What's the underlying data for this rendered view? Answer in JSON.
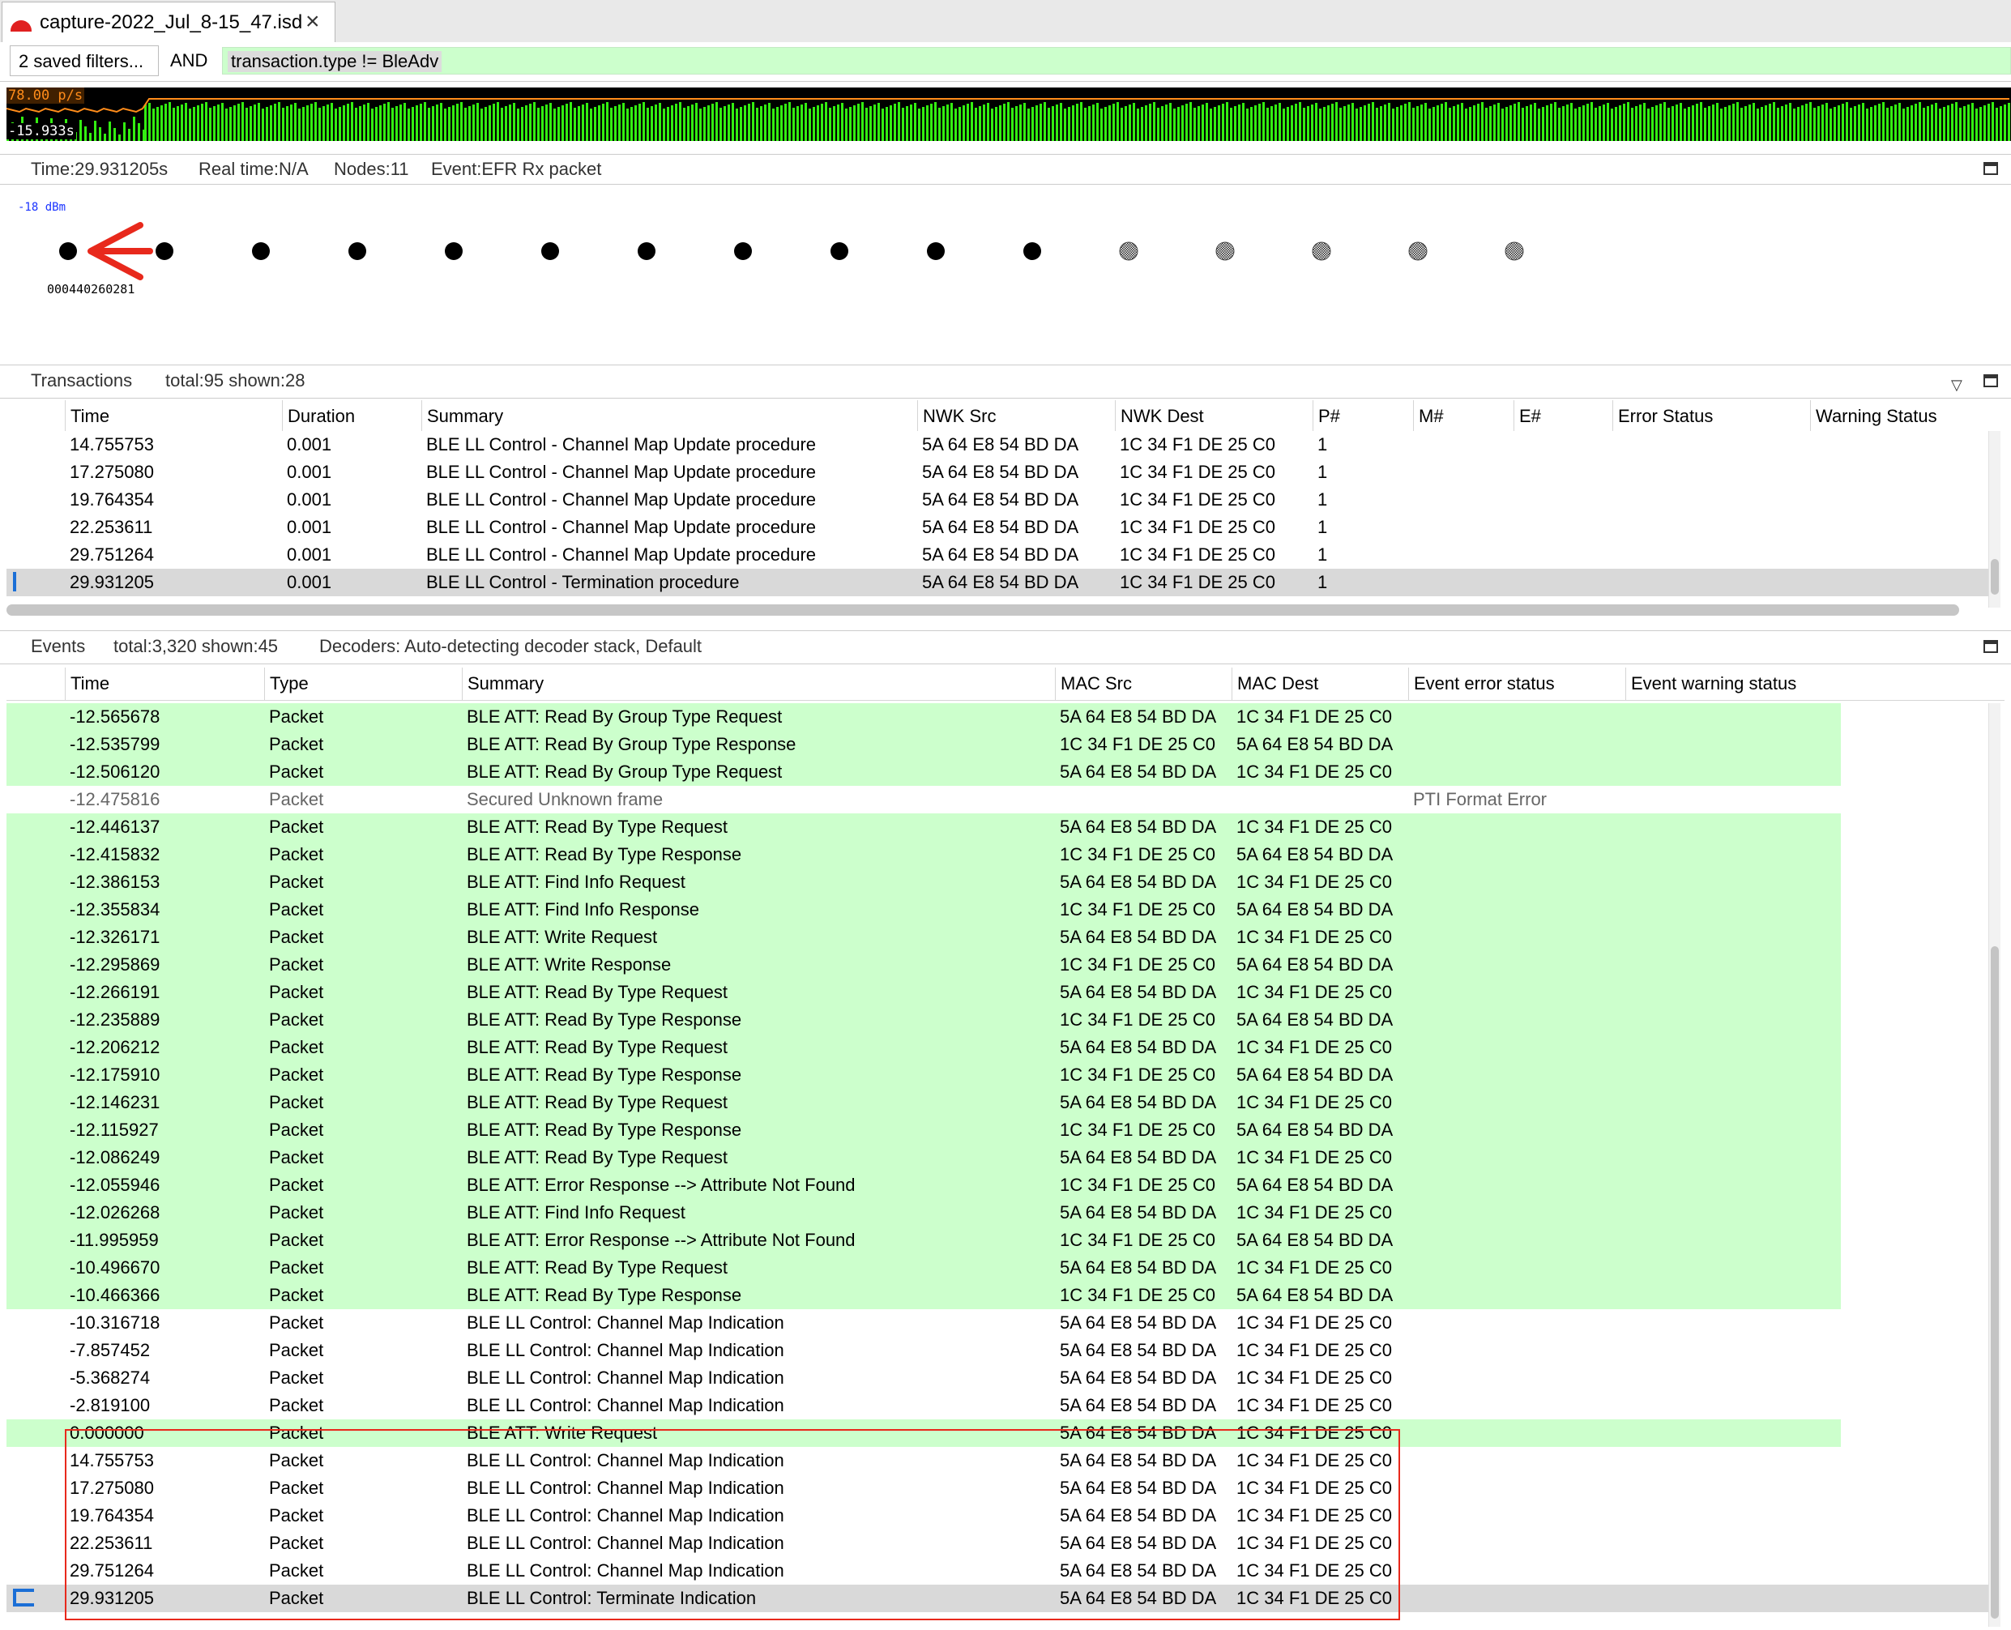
{
  "tab": {
    "title": "capture-2022_Jul_8-15_47.isd"
  },
  "filter": {
    "saved_filters": "2 saved filters...",
    "operator": "AND",
    "expression": "transaction.type != BleAdv"
  },
  "activity": {
    "top_label": "78.00 p/s",
    "bottom_label": "-15.933s"
  },
  "node_info": {
    "time": "Time:29.931205s",
    "real_time": "Real time:N/A",
    "nodes": "Nodes:11",
    "event": "Event:EFR Rx packet",
    "dbm_label": "-18 dBm",
    "node_id": "000440260281"
  },
  "nodes": {
    "active_count": 11,
    "inactive_count": 5
  },
  "transactions": {
    "title": "Transactions",
    "stats": "total:95 shown:28",
    "columns": [
      "Time",
      "Duration",
      "Summary",
      "NWK Src",
      "NWK Dest",
      "P#",
      "M#",
      "E#",
      "Error Status",
      "Warning Status"
    ],
    "rows": [
      {
        "time": "14.755753",
        "duration": "0.001",
        "summary": "BLE LL Control - Channel Map Update procedure",
        "src": "5A 64 E8 54 BD DA",
        "dest": "1C 34 F1 DE 25 C0",
        "p": "1"
      },
      {
        "time": "17.275080",
        "duration": "0.001",
        "summary": "BLE LL Control - Channel Map Update procedure",
        "src": "5A 64 E8 54 BD DA",
        "dest": "1C 34 F1 DE 25 C0",
        "p": "1"
      },
      {
        "time": "19.764354",
        "duration": "0.001",
        "summary": "BLE LL Control - Channel Map Update procedure",
        "src": "5A 64 E8 54 BD DA",
        "dest": "1C 34 F1 DE 25 C0",
        "p": "1"
      },
      {
        "time": "22.253611",
        "duration": "0.001",
        "summary": "BLE LL Control - Channel Map Update procedure",
        "src": "5A 64 E8 54 BD DA",
        "dest": "1C 34 F1 DE 25 C0",
        "p": "1"
      },
      {
        "time": "29.751264",
        "duration": "0.001",
        "summary": "BLE LL Control - Channel Map Update procedure",
        "src": "5A 64 E8 54 BD DA",
        "dest": "1C 34 F1 DE 25 C0",
        "p": "1"
      },
      {
        "time": "29.931205",
        "duration": "0.001",
        "summary": "BLE LL Control - Termination procedure",
        "src": "5A 64 E8 54 BD DA",
        "dest": "1C 34 F1 DE 25 C0",
        "p": "1",
        "selected": true
      }
    ]
  },
  "events": {
    "title": "Events",
    "stats": "total:3,320 shown:45",
    "decoders": "Decoders: Auto-detecting decoder stack, Default",
    "columns": [
      "Time",
      "Type",
      "Summary",
      "MAC Src",
      "MAC Dest",
      "Event error status",
      "Event warning status"
    ],
    "rows": [
      {
        "time": "-12.565678",
        "type": "Packet",
        "summary": "BLE ATT: Read By Group Type Request",
        "src": "5A 64 E8 54 BD DA",
        "dest": "1C 34 F1 DE 25 C0",
        "bg": "green"
      },
      {
        "time": "-12.535799",
        "type": "Packet",
        "summary": "BLE ATT: Read By Group Type Response",
        "src": "1C 34 F1 DE 25 C0",
        "dest": "5A 64 E8 54 BD DA",
        "bg": "green"
      },
      {
        "time": "-12.506120",
        "type": "Packet",
        "summary": "BLE ATT: Read By Group Type Request",
        "src": "5A 64 E8 54 BD DA",
        "dest": "1C 34 F1 DE 25 C0",
        "bg": "green"
      },
      {
        "time": "-12.475816",
        "type": "Packet",
        "summary": "Secured Unknown frame",
        "src": "",
        "dest": "",
        "error": "PTI Format Error",
        "bg": "white",
        "gray": true
      },
      {
        "time": "-12.446137",
        "type": "Packet",
        "summary": "BLE ATT: Read By Type Request",
        "src": "5A 64 E8 54 BD DA",
        "dest": "1C 34 F1 DE 25 C0",
        "bg": "green"
      },
      {
        "time": "-12.415832",
        "type": "Packet",
        "summary": "BLE ATT: Read By Type Response",
        "src": "1C 34 F1 DE 25 C0",
        "dest": "5A 64 E8 54 BD DA",
        "bg": "green"
      },
      {
        "time": "-12.386153",
        "type": "Packet",
        "summary": "BLE ATT: Find Info Request",
        "src": "5A 64 E8 54 BD DA",
        "dest": "1C 34 F1 DE 25 C0",
        "bg": "green"
      },
      {
        "time": "-12.355834",
        "type": "Packet",
        "summary": "BLE ATT: Find Info Response",
        "src": "1C 34 F1 DE 25 C0",
        "dest": "5A 64 E8 54 BD DA",
        "bg": "green"
      },
      {
        "time": "-12.326171",
        "type": "Packet",
        "summary": "BLE ATT: Write Request",
        "src": "5A 64 E8 54 BD DA",
        "dest": "1C 34 F1 DE 25 C0",
        "bg": "green"
      },
      {
        "time": "-12.295869",
        "type": "Packet",
        "summary": "BLE ATT: Write Response",
        "src": "1C 34 F1 DE 25 C0",
        "dest": "5A 64 E8 54 BD DA",
        "bg": "green"
      },
      {
        "time": "-12.266191",
        "type": "Packet",
        "summary": "BLE ATT: Read By Type Request",
        "src": "5A 64 E8 54 BD DA",
        "dest": "1C 34 F1 DE 25 C0",
        "bg": "green"
      },
      {
        "time": "-12.235889",
        "type": "Packet",
        "summary": "BLE ATT: Read By Type Response",
        "src": "1C 34 F1 DE 25 C0",
        "dest": "5A 64 E8 54 BD DA",
        "bg": "green"
      },
      {
        "time": "-12.206212",
        "type": "Packet",
        "summary": "BLE ATT: Read By Type Request",
        "src": "5A 64 E8 54 BD DA",
        "dest": "1C 34 F1 DE 25 C0",
        "bg": "green"
      },
      {
        "time": "-12.175910",
        "type": "Packet",
        "summary": "BLE ATT: Read By Type Response",
        "src": "1C 34 F1 DE 25 C0",
        "dest": "5A 64 E8 54 BD DA",
        "bg": "green"
      },
      {
        "time": "-12.146231",
        "type": "Packet",
        "summary": "BLE ATT: Read By Type Request",
        "src": "5A 64 E8 54 BD DA",
        "dest": "1C 34 F1 DE 25 C0",
        "bg": "green"
      },
      {
        "time": "-12.115927",
        "type": "Packet",
        "summary": "BLE ATT: Read By Type Response",
        "src": "1C 34 F1 DE 25 C0",
        "dest": "5A 64 E8 54 BD DA",
        "bg": "green"
      },
      {
        "time": "-12.086249",
        "type": "Packet",
        "summary": "BLE ATT: Read By Type Request",
        "src": "5A 64 E8 54 BD DA",
        "dest": "1C 34 F1 DE 25 C0",
        "bg": "green"
      },
      {
        "time": "-12.055946",
        "type": "Packet",
        "summary": "BLE ATT: Error Response --> Attribute Not Found",
        "src": "1C 34 F1 DE 25 C0",
        "dest": "5A 64 E8 54 BD DA",
        "bg": "green"
      },
      {
        "time": "-12.026268",
        "type": "Packet",
        "summary": "BLE ATT: Find Info Request",
        "src": "5A 64 E8 54 BD DA",
        "dest": "1C 34 F1 DE 25 C0",
        "bg": "green"
      },
      {
        "time": "-11.995959",
        "type": "Packet",
        "summary": "BLE ATT: Error Response --> Attribute Not Found",
        "src": "1C 34 F1 DE 25 C0",
        "dest": "5A 64 E8 54 BD DA",
        "bg": "green"
      },
      {
        "time": "-10.496670",
        "type": "Packet",
        "summary": "BLE ATT: Read By Type Request",
        "src": "5A 64 E8 54 BD DA",
        "dest": "1C 34 F1 DE 25 C0",
        "bg": "green"
      },
      {
        "time": "-10.466366",
        "type": "Packet",
        "summary": "BLE ATT: Read By Type Response",
        "src": "1C 34 F1 DE 25 C0",
        "dest": "5A 64 E8 54 BD DA",
        "bg": "green"
      },
      {
        "time": "-10.316718",
        "type": "Packet",
        "summary": "BLE LL Control: Channel Map Indication",
        "src": "5A 64 E8 54 BD DA",
        "dest": "1C 34 F1 DE 25 C0",
        "bg": "white"
      },
      {
        "time": "-7.857452",
        "type": "Packet",
        "summary": "BLE LL Control: Channel Map Indication",
        "src": "5A 64 E8 54 BD DA",
        "dest": "1C 34 F1 DE 25 C0",
        "bg": "white"
      },
      {
        "time": "-5.368274",
        "type": "Packet",
        "summary": "BLE LL Control: Channel Map Indication",
        "src": "5A 64 E8 54 BD DA",
        "dest": "1C 34 F1 DE 25 C0",
        "bg": "white"
      },
      {
        "time": "-2.819100",
        "type": "Packet",
        "summary": "BLE LL Control: Channel Map Indication",
        "src": "5A 64 E8 54 BD DA",
        "dest": "1C 34 F1 DE 25 C0",
        "bg": "white"
      },
      {
        "time": "0.000000",
        "type": "Packet",
        "summary": "BLE ATT: Write Request",
        "src": "5A 64 E8 54 BD DA",
        "dest": "1C 34 F1 DE 25 C0",
        "bg": "green"
      },
      {
        "time": "14.755753",
        "type": "Packet",
        "summary": "BLE LL Control: Channel Map Indication",
        "src": "5A 64 E8 54 BD DA",
        "dest": "1C 34 F1 DE 25 C0",
        "bg": "white"
      },
      {
        "time": "17.275080",
        "type": "Packet",
        "summary": "BLE LL Control: Channel Map Indication",
        "src": "5A 64 E8 54 BD DA",
        "dest": "1C 34 F1 DE 25 C0",
        "bg": "white"
      },
      {
        "time": "19.764354",
        "type": "Packet",
        "summary": "BLE LL Control: Channel Map Indication",
        "src": "5A 64 E8 54 BD DA",
        "dest": "1C 34 F1 DE 25 C0",
        "bg": "white"
      },
      {
        "time": "22.253611",
        "type": "Packet",
        "summary": "BLE LL Control: Channel Map Indication",
        "src": "5A 64 E8 54 BD DA",
        "dest": "1C 34 F1 DE 25 C0",
        "bg": "white"
      },
      {
        "time": "29.751264",
        "type": "Packet",
        "summary": "BLE LL Control: Channel Map Indication",
        "src": "5A 64 E8 54 BD DA",
        "dest": "1C 34 F1 DE 25 C0",
        "bg": "white"
      },
      {
        "time": "29.931205",
        "type": "Packet",
        "summary": "BLE LL Control: Terminate Indication",
        "src": "5A 64 E8 54 BD DA",
        "dest": "1C 34 F1 DE 25 C0",
        "bg": "selected"
      }
    ]
  },
  "colors": {
    "row_green": "#ccffcc",
    "row_selected": "#d9d9d9",
    "filter_bg": "#ccffcc",
    "highlight_box": "#e8291c",
    "arrow": "#e8291c",
    "activity_bars": "#33ee11",
    "activity_line": "#ff8c1a",
    "dbm_text": "#1a33ff"
  }
}
